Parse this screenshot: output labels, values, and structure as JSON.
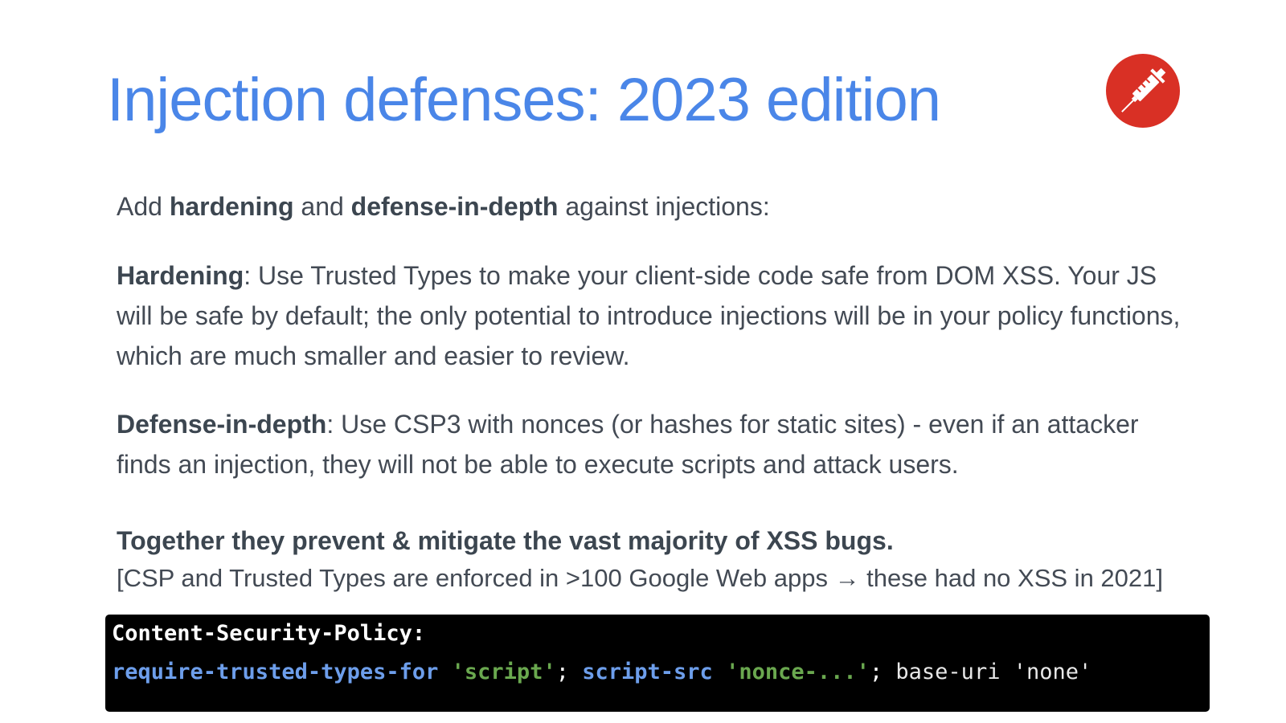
{
  "slide": {
    "title": "Injection defenses: 2023 edition",
    "badge_icon": "syringe-icon",
    "badge_color": "#d93025",
    "intro": {
      "pre": "Add ",
      "bold1": "hardening",
      "mid": " and ",
      "bold2": "defense-in-depth",
      "post": " against injections:"
    },
    "hardening": {
      "label": "Hardening",
      "text": ": Use Trusted Types to make your client-side code safe from DOM XSS. Your JS will be safe by default; the only potential to introduce injections will be in your policy functions, which are much smaller and easier to review."
    },
    "defense": {
      "label": "Defense-in-depth",
      "text": ": Use CSP3 with nonces (or hashes for static sites) - even if an attacker finds an injection, they will not be able to execute scripts and attack users."
    },
    "together": "Together they prevent & mitigate the vast majority of XSS bugs.",
    "note": "[CSP and Trusted Types are enforced in >100 Google Web apps → these had no XSS in 2021]",
    "code": {
      "header": "Content-Security-Policy:",
      "directive1": "require-trusted-types-for",
      "value1": "'script'",
      "sep1": ";",
      "directive2": "script-src",
      "value2": "'nonce-...'",
      "sep2": ";",
      "tail": "base-uri 'none'"
    }
  }
}
